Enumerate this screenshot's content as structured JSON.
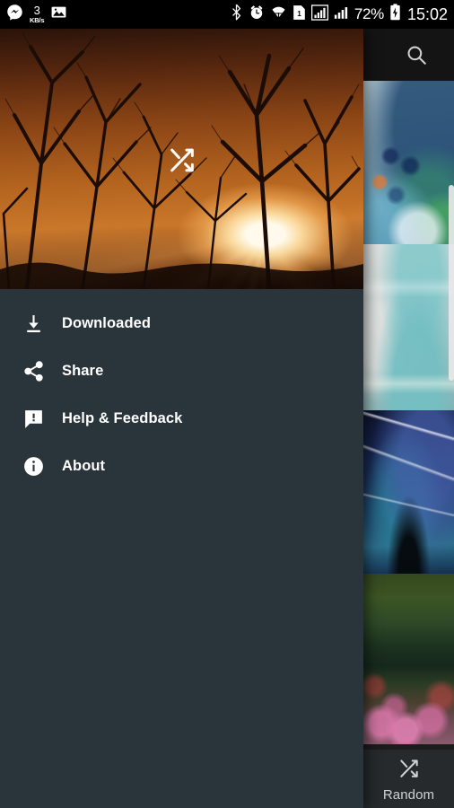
{
  "status_bar": {
    "messenger_icon": "messenger-icon",
    "data_rate_value": "3",
    "data_rate_unit": "KB/s",
    "photo_icon": "photo-icon",
    "bluetooth_icon": "bluetooth-icon",
    "alarm_icon": "alarm-clock-icon",
    "wifi_icon": "wifi-icon",
    "sim_label": "1",
    "signal_icon_1": "signal-bars-icon",
    "signal_icon_2": "signal-bars-icon",
    "battery_percent": "72%",
    "battery_icon": "battery-charging-icon",
    "time": "15:02"
  },
  "app_bar": {
    "search_icon": "search-icon"
  },
  "drawer": {
    "hero": {
      "description": "sunset-through-bare-trees",
      "shuffle_icon": "shuffle-icon"
    },
    "items": [
      {
        "label": "Downloaded",
        "icon": "download-icon"
      },
      {
        "label": "Share",
        "icon": "share-icon"
      },
      {
        "label": "Help & Feedback",
        "icon": "feedback-icon"
      },
      {
        "label": "About",
        "icon": "info-icon"
      }
    ]
  },
  "grid": {
    "thumbnails": [
      {
        "name": "aquarium-fish-wallpaper"
      },
      {
        "name": "teal-macarons-wallpaper"
      },
      {
        "name": "aurora-night-sky-wallpaper"
      },
      {
        "name": "tulip-garden-pond-wallpaper"
      }
    ],
    "scrollbar": "vertical-scrollbar"
  },
  "bottom_bar": {
    "random_label": "Random",
    "random_icon": "shuffle-icon"
  },
  "colors": {
    "drawer_bg": "#2a343b",
    "status_bar_bg": "#000000",
    "app_bar_bg": "#141414",
    "text_primary": "#ffffff",
    "random_text": "#cfd2d4"
  }
}
